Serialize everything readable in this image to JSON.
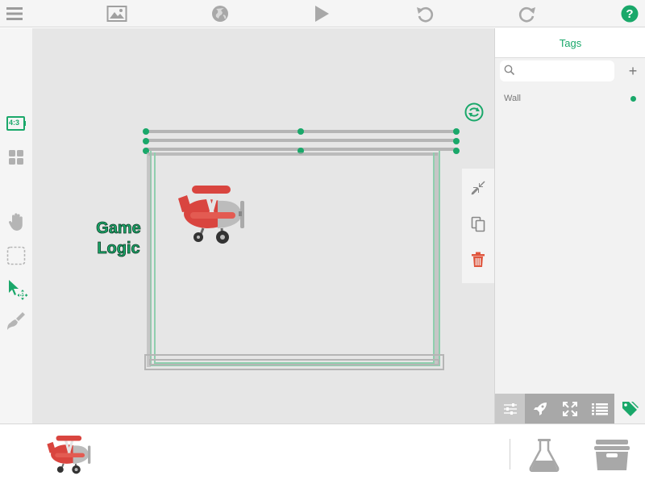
{
  "canvas": {
    "aspect_label": "4:3",
    "game_logic_text": [
      "Game",
      "Logic"
    ]
  },
  "tags_panel": {
    "title": "Tags",
    "search_placeholder": "",
    "add_symbol": "+",
    "tags": [
      {
        "label": "Wall",
        "selected": true
      }
    ]
  },
  "icons": {
    "toolbar": [
      "menu-icon",
      "image-icon",
      "globe-icon",
      "play-icon",
      "undo-icon",
      "redo-icon",
      "help-icon"
    ],
    "left_tools": [
      "aspect-ratio-icon",
      "grid-icon",
      "hand-icon",
      "selection-icon",
      "pointer-move-icon",
      "brush-icon"
    ],
    "object_tools": [
      "rotate-icon",
      "shrink-icon",
      "duplicate-icon",
      "delete-icon"
    ],
    "panel_tabs": [
      "sliders-icon",
      "rocket-icon",
      "expand-icon",
      "list-icon",
      "tag-icon"
    ],
    "bottom": [
      "biplane-sprite",
      "flask-icon",
      "archive-box-icon"
    ]
  },
  "colors": {
    "accent": "#1aa86a",
    "delete": "#e0563e",
    "plane_red": "#d9453f"
  }
}
